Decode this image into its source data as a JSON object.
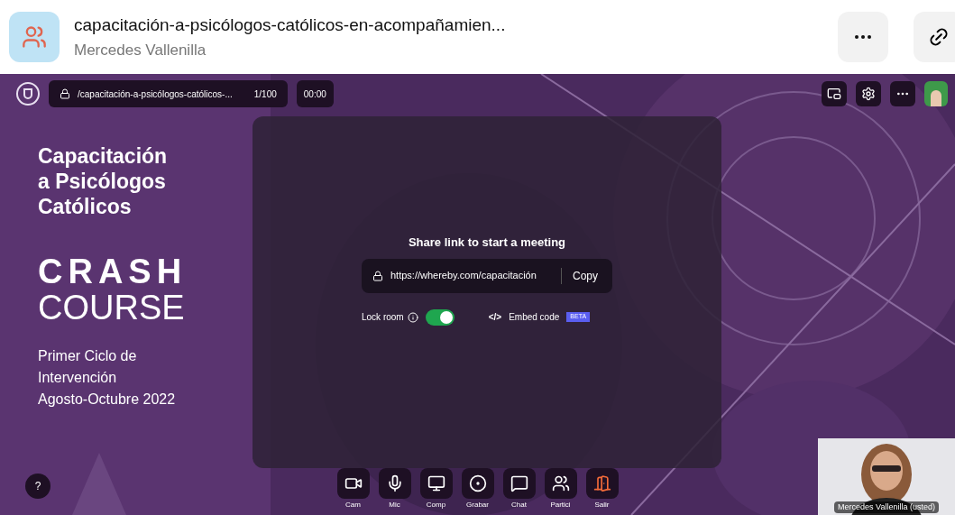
{
  "header": {
    "title": "capacitación-a-psicólogos-católicos-en-acompañamien...",
    "subtitle": "Mercedes Vallenilla"
  },
  "room_bar": {
    "path": "/capacitación-a-psicólogos-católicos-...",
    "count": "1/100",
    "timer": "00:00"
  },
  "background_text": {
    "title": "Capacitación a Psicólogos Católicos",
    "heading_1": "CRASH",
    "heading_2": "COURSE",
    "details": [
      "Primer Ciclo de",
      "Intervención",
      "Agosto-Octubre 2022"
    ]
  },
  "share": {
    "title": "Share link to start a meeting",
    "link": "https://whereby.com/capacitación",
    "copy": "Copy",
    "lock_label": "Lock room",
    "lock_on": true,
    "embed_icon": "</>",
    "embed_label": "Embed code",
    "badge": "BETA"
  },
  "help": "?",
  "toolbar": [
    {
      "kind": "cam",
      "label": "Cam"
    },
    {
      "kind": "mic",
      "label": "Mic"
    },
    {
      "kind": "screen",
      "label": "Comp"
    },
    {
      "kind": "record",
      "label": "Grabar"
    },
    {
      "kind": "chat",
      "label": "Chat"
    },
    {
      "kind": "people",
      "label": "Partici"
    },
    {
      "kind": "leave",
      "label": "Salir"
    }
  ],
  "self_view": {
    "name": "Mercedes Vallenilla (usted)"
  }
}
